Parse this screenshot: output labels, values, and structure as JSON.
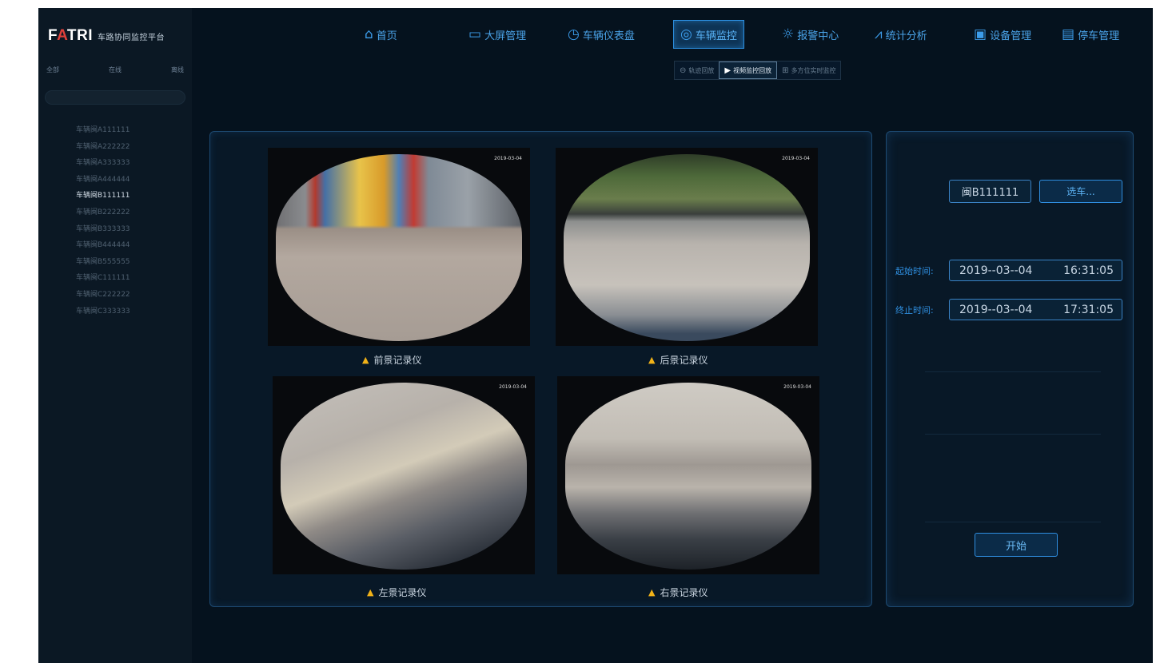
{
  "sidebar": {
    "logo_mark_a": "F",
    "logo_mark_b": "A",
    "logo_mark_c": "TRI",
    "logo_subtitle": "车路协同监控平台",
    "tabs": [
      "全部",
      "在线",
      "离线"
    ],
    "vehicles": [
      {
        "label": "车辆闽A111111",
        "active": false
      },
      {
        "label": "车辆闽A222222",
        "active": false
      },
      {
        "label": "车辆闽A333333",
        "active": false
      },
      {
        "label": "车辆闽A444444",
        "active": false
      },
      {
        "label": "车辆闽B111111",
        "active": true
      },
      {
        "label": "车辆闽B222222",
        "active": false
      },
      {
        "label": "车辆闽B333333",
        "active": false
      },
      {
        "label": "车辆闽B444444",
        "active": false
      },
      {
        "label": "车辆闽B555555",
        "active": false
      },
      {
        "label": "车辆闽C111111",
        "active": false
      },
      {
        "label": "车辆闽C222222",
        "active": false
      },
      {
        "label": "车辆闽C333333",
        "active": false
      }
    ]
  },
  "nav": {
    "home": "首页",
    "bigscreen": "大屏管理",
    "dashboard": "车辆仪表盘",
    "monitor": "车辆监控",
    "alarm": "报警中心",
    "stats": "统计分析",
    "devices": "设备管理",
    "parking": "停车管理"
  },
  "subnav": {
    "track": "轨迹回放",
    "video_playback": "视频监控回放",
    "realtime": "多方位实时监控"
  },
  "cameras": {
    "front": "前景记录仪",
    "rear": "后景记录仪",
    "left": "左景记录仪",
    "right": "右景记录仪",
    "timestamp": "2019-03-04"
  },
  "control": {
    "plate": "闽B111111",
    "choose_btn": "选车...",
    "start_label": "起始时间:",
    "start_date": "2019--03--04",
    "start_time": "16:31:05",
    "end_label": "终止时间:",
    "end_date": "2019--03--04",
    "end_time": "17:31:05",
    "start_btn": "开始"
  },
  "colors": {
    "accent": "#2f8ee0",
    "background": "#05121e",
    "warning": "#f1b218"
  },
  "icons": {
    "home": "home-icon",
    "bigscreen": "monitor-icon",
    "dashboard": "gauge-icon",
    "monitor": "camera-icon",
    "alarm": "alarm-light-icon",
    "stats": "line-chart-icon",
    "devices": "device-icon",
    "parking": "parking-icon"
  }
}
